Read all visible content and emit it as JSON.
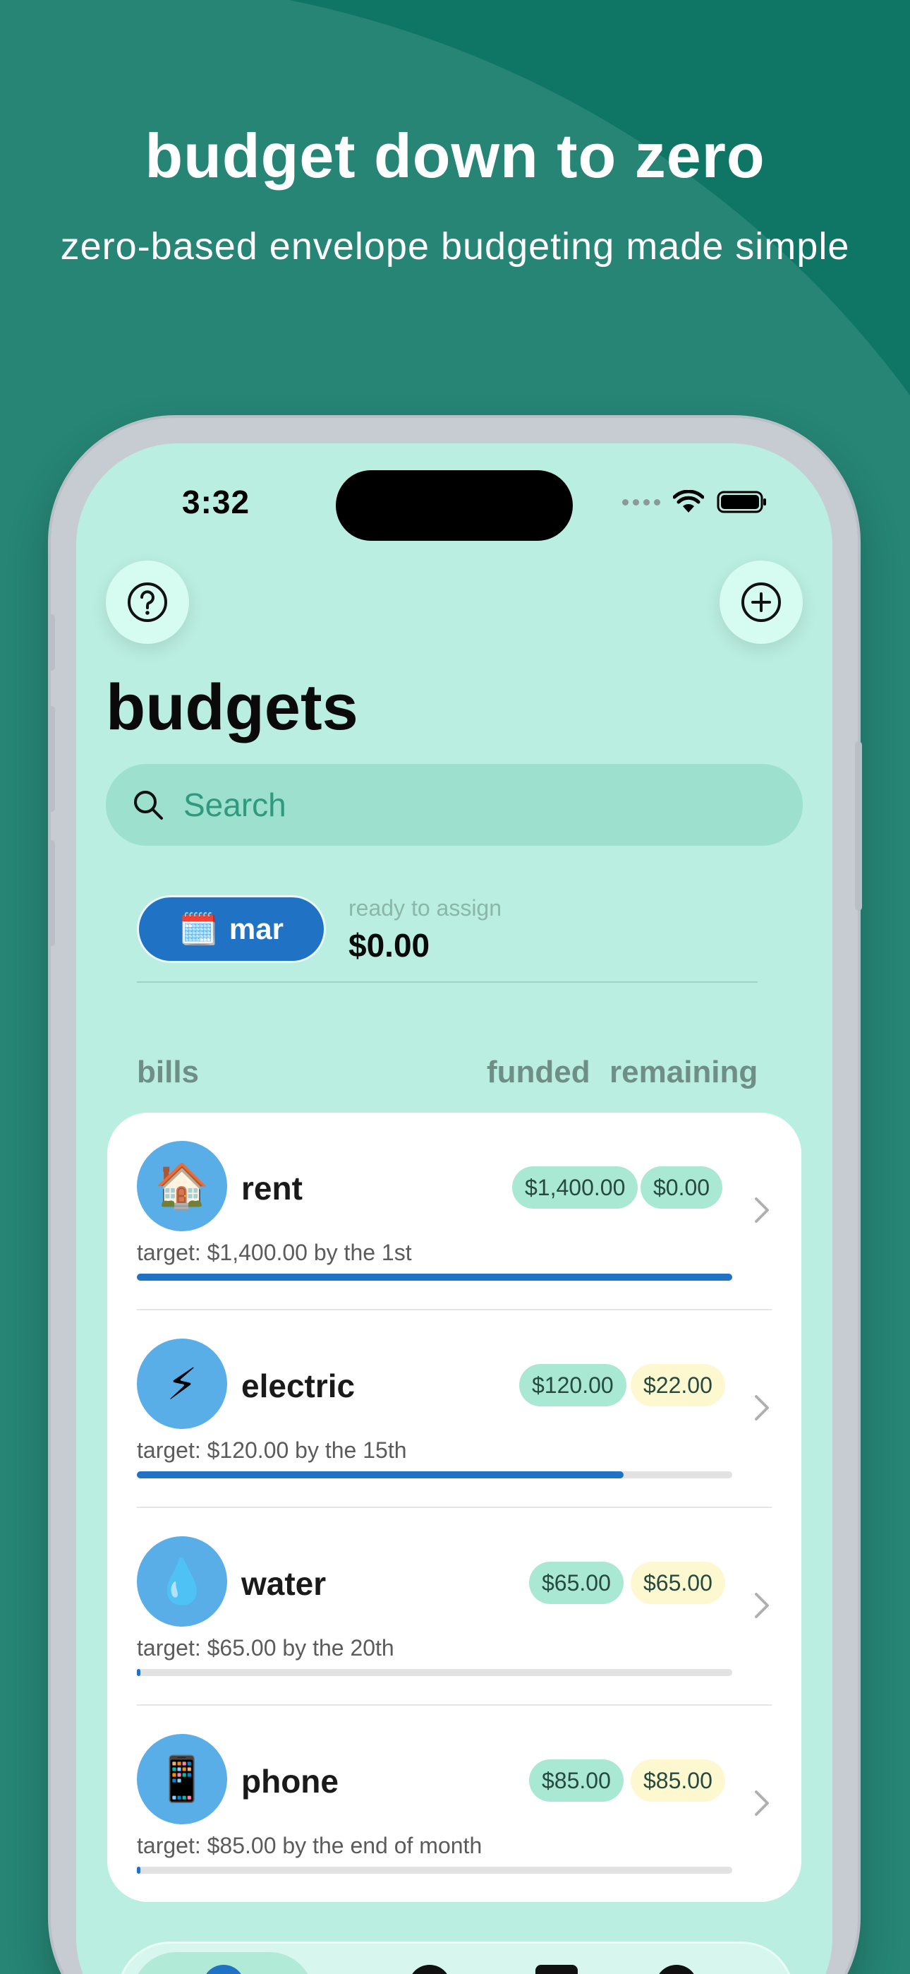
{
  "hero": {
    "title": "budget down to zero",
    "subtitle": "zero-based envelope budgeting made simple"
  },
  "status_bar": {
    "time": "3:32"
  },
  "header": {
    "help_icon": "question-circle-icon",
    "add_icon": "plus-circle-icon",
    "title": "budgets"
  },
  "search": {
    "placeholder": "Search",
    "icon": "search-icon"
  },
  "summary": {
    "month_icon": "calendar-emoji",
    "month_label": "mar",
    "ready_label": "ready to assign",
    "ready_value": "$0.00"
  },
  "section": {
    "name": "bills",
    "col_funded": "funded",
    "col_remaining": "remaining"
  },
  "envelopes": [
    {
      "icon": "🏠",
      "name": "rent",
      "funded": "$1,400.00",
      "remaining": "$0.00",
      "remaining_style": "green",
      "target": "target: $1,400.00 by the 1st",
      "progress": 1.0
    },
    {
      "icon": "⚡",
      "name": "electric",
      "funded": "$120.00",
      "remaining": "$22.00",
      "remaining_style": "yellow",
      "target": "target: $120.00 by the 15th",
      "progress": 0.817
    },
    {
      "icon": "💧",
      "name": "water",
      "funded": "$65.00",
      "remaining": "$65.00",
      "remaining_style": "yellow",
      "target": "target: $65.00 by the 20th",
      "progress": 0.0
    },
    {
      "icon": "📱",
      "name": "phone",
      "funded": "$85.00",
      "remaining": "$85.00",
      "remaining_style": "yellow",
      "target": "target: $85.00 by the end of month",
      "progress": 0.0
    }
  ],
  "colors": {
    "background": "#268575",
    "screen": "#baeee0",
    "accent_blue": "#1f72c4",
    "pill_green": "#a9e8d3",
    "pill_yellow": "#fdf8cf"
  }
}
